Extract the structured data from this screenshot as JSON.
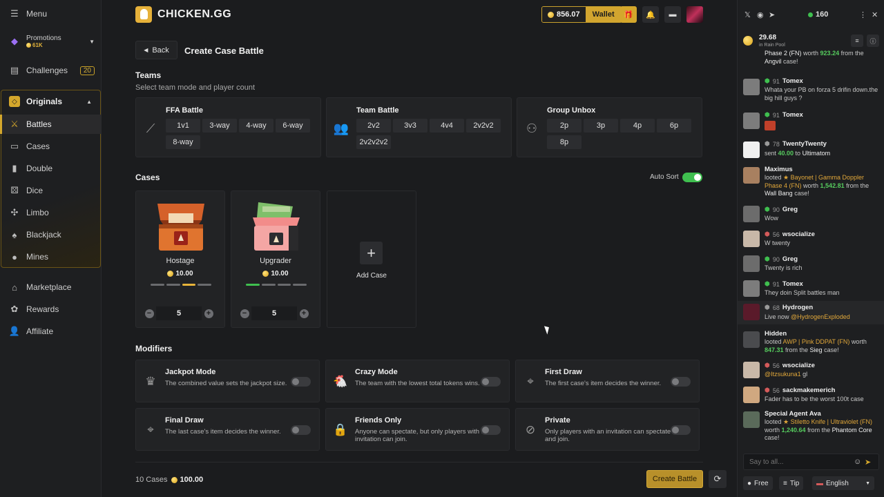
{
  "sidebar": {
    "menu_label": "Menu",
    "promotions": {
      "label": "Promotions",
      "amount": "61K"
    },
    "challenges": {
      "label": "Challenges",
      "count": "20"
    },
    "originals_label": "Originals",
    "originals": [
      {
        "label": "Battles",
        "icon": "swords-icon"
      },
      {
        "label": "Cases",
        "icon": "case-icon"
      },
      {
        "label": "Double",
        "icon": "double-icon"
      },
      {
        "label": "Dice",
        "icon": "dice-icon"
      },
      {
        "label": "Limbo",
        "icon": "limbo-icon"
      },
      {
        "label": "Blackjack",
        "icon": "cards-icon"
      },
      {
        "label": "Mines",
        "icon": "bomb-icon"
      }
    ],
    "bottom": [
      {
        "label": "Marketplace",
        "icon": "market-icon"
      },
      {
        "label": "Rewards",
        "icon": "rewards-icon"
      },
      {
        "label": "Affiliate",
        "icon": "affiliate-icon"
      }
    ]
  },
  "topbar": {
    "brand": "CHICKEN.GG",
    "balance": "856.07",
    "wallet_label": "Wallet"
  },
  "page": {
    "back_label": "Back",
    "title": "Create Case Battle",
    "teams_title": "Teams",
    "teams_subtitle": "Select team mode and player count",
    "modes": [
      {
        "name": "FFA Battle",
        "options": [
          "1v1",
          "3-way",
          "4-way",
          "6-way",
          "8-way"
        ]
      },
      {
        "name": "Team Battle",
        "options": [
          "2v2",
          "3v3",
          "4v4",
          "2v2v2",
          "2v2v2v2"
        ]
      },
      {
        "name": "Group Unbox",
        "options": [
          "2p",
          "3p",
          "4p",
          "6p",
          "8p"
        ]
      }
    ],
    "cases_title": "Cases",
    "auto_sort_label": "Auto Sort",
    "auto_sort_on": true,
    "cases": [
      {
        "name": "Hostage",
        "price": "10.00",
        "quantity": "5"
      },
      {
        "name": "Upgrader",
        "price": "10.00",
        "quantity": "5"
      }
    ],
    "add_case_label": "Add Case",
    "modifiers_title": "Modifiers",
    "modifiers": [
      {
        "title": "Jackpot Mode",
        "desc": "The combined value sets the jackpot size.",
        "icon": "crown-icon",
        "on": false
      },
      {
        "title": "Crazy Mode",
        "desc": "The team with the lowest total tokens wins.",
        "icon": "chicken-icon",
        "on": false
      },
      {
        "title": "First Draw",
        "desc": "The first case's item decides the winner.",
        "icon": "crosshair-icon",
        "on": false
      },
      {
        "title": "Final Draw",
        "desc": "The last case's item decides the winner.",
        "icon": "crosshair-icon",
        "on": false
      },
      {
        "title": "Friends Only",
        "desc": "Anyone can spectate, but only players with an invitation can join.",
        "icon": "lock-icon",
        "on": false
      },
      {
        "title": "Private",
        "desc": "Only players with an invitation can spectate and join.",
        "icon": "eye-off-icon",
        "on": false
      }
    ],
    "footer": {
      "cases_count": "10 Cases",
      "total": "100.00",
      "create_label": "Create Battle"
    }
  },
  "chat": {
    "online_count": "160",
    "rain_amount": "29.68",
    "rain_label": "in Rain Pool",
    "input_placeholder": "Say to all...",
    "free_label": "Free",
    "tip_label": "Tip",
    "language": "English",
    "messages": [
      {
        "level": "",
        "user": "",
        "body_html": "<span class='w'>Phase 2 (FN)</span> worth <span class='green'>923.24</span> from the <span class='w'>Angvil</span> case!"
      },
      {
        "level": "91",
        "user": "Tomex",
        "body_html": "Whata your PB on forza 5 drifin down.the big hill guys ?"
      },
      {
        "level": "91",
        "user": "Tomex",
        "body_html": ""
      },
      {
        "level": "78",
        "user": "TwentyTwenty",
        "body_html": "sent <span class='green'>40.00</span> to <span class='w'>Ultimatom</span>"
      },
      {
        "level": "",
        "user": "Maximus",
        "body_html": "looted <span class='gold'>★ Bayonet | Gamma Doppler Phase 4 (FN)</span> worth <span class='green'>1,542.81</span> from the <span class='w'>Wall Bang</span> case!"
      },
      {
        "level": "90",
        "user": "Greg",
        "body_html": "Wow"
      },
      {
        "level": "56",
        "user": "wsocialize",
        "body_html": "W twenty"
      },
      {
        "level": "90",
        "user": "Greg",
        "body_html": "Twenty is rich"
      },
      {
        "level": "91",
        "user": "Tomex",
        "body_html": "They doin Split battles man"
      },
      {
        "level": "68",
        "user": "Hydrogen",
        "body_html": "Live now <span class='gold'>@HydrogenExploded</span>"
      },
      {
        "level": "",
        "user": "Hidden",
        "body_html": "looted <span class='gold'>AWP | Pink DDPAT (FN)</span> worth <span class='green'>847.31</span> from the <span class='w'>Sieg</span> case!"
      },
      {
        "level": "56",
        "user": "wsocialize",
        "body_html": "<span class='gold'>@Itzsukuna1</span> gl"
      },
      {
        "level": "56",
        "user": "sackmakemerich",
        "body_html": "Fader has to be the worst 100t case"
      },
      {
        "level": "",
        "user": "Special Agent Ava",
        "body_html": "looted <span class='gold'>★ Stiletto Knife | Ultraviolet (FN)</span> worth <span class='green'>1,240.64</span> from the <span class='w'>Phantom Core</span> case!"
      }
    ]
  }
}
